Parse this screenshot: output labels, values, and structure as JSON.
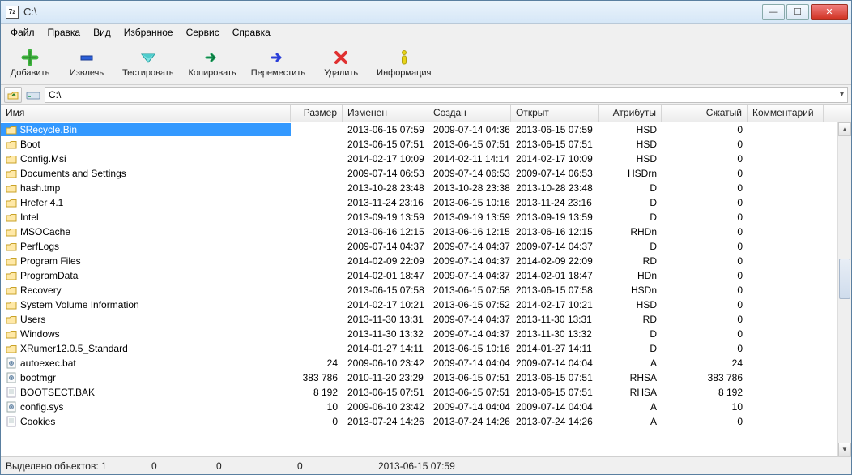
{
  "window": {
    "title": "C:\\"
  },
  "menu": {
    "items": [
      "Файл",
      "Правка",
      "Вид",
      "Избранное",
      "Сервис",
      "Справка"
    ]
  },
  "toolbar": {
    "buttons": [
      {
        "key": "add",
        "label": "Добавить"
      },
      {
        "key": "extract",
        "label": "Извлечь"
      },
      {
        "key": "test",
        "label": "Тестировать"
      },
      {
        "key": "copy",
        "label": "Копировать"
      },
      {
        "key": "move",
        "label": "Переместить"
      },
      {
        "key": "delete",
        "label": "Удалить"
      },
      {
        "key": "info",
        "label": "Информация"
      }
    ]
  },
  "path": {
    "value": "C:\\"
  },
  "columns": {
    "name": "Имя",
    "size": "Размер",
    "modified": "Изменен",
    "created": "Создан",
    "accessed": "Открыт",
    "attr": "Атрибуты",
    "compressed": "Сжатый",
    "comment": "Комментарий"
  },
  "rows": [
    {
      "type": "folder",
      "name": "$Recycle.Bin",
      "size": "",
      "mod": "2013-06-15 07:59",
      "crt": "2009-07-14 04:36",
      "acc": "2013-06-15 07:59",
      "attr": "HSD",
      "comp": "0",
      "sel": true
    },
    {
      "type": "folder",
      "name": "Boot",
      "size": "",
      "mod": "2013-06-15 07:51",
      "crt": "2013-06-15 07:51",
      "acc": "2013-06-15 07:51",
      "attr": "HSD",
      "comp": "0"
    },
    {
      "type": "folder",
      "name": "Config.Msi",
      "size": "",
      "mod": "2014-02-17 10:09",
      "crt": "2014-02-11 14:14",
      "acc": "2014-02-17 10:09",
      "attr": "HSD",
      "comp": "0"
    },
    {
      "type": "folder",
      "name": "Documents and Settings",
      "size": "",
      "mod": "2009-07-14 06:53",
      "crt": "2009-07-14 06:53",
      "acc": "2009-07-14 06:53",
      "attr": "HSDrn",
      "comp": "0"
    },
    {
      "type": "folder",
      "name": "hash.tmp",
      "size": "",
      "mod": "2013-10-28 23:48",
      "crt": "2013-10-28 23:38",
      "acc": "2013-10-28 23:48",
      "attr": "D",
      "comp": "0"
    },
    {
      "type": "folder",
      "name": "Hrefer 4.1",
      "size": "",
      "mod": "2013-11-24 23:16",
      "crt": "2013-06-15 10:16",
      "acc": "2013-11-24 23:16",
      "attr": "D",
      "comp": "0"
    },
    {
      "type": "folder",
      "name": "Intel",
      "size": "",
      "mod": "2013-09-19 13:59",
      "crt": "2013-09-19 13:59",
      "acc": "2013-09-19 13:59",
      "attr": "D",
      "comp": "0"
    },
    {
      "type": "folder",
      "name": "MSOCache",
      "size": "",
      "mod": "2013-06-16 12:15",
      "crt": "2013-06-16 12:15",
      "acc": "2013-06-16 12:15",
      "attr": "RHDn",
      "comp": "0"
    },
    {
      "type": "folder",
      "name": "PerfLogs",
      "size": "",
      "mod": "2009-07-14 04:37",
      "crt": "2009-07-14 04:37",
      "acc": "2009-07-14 04:37",
      "attr": "D",
      "comp": "0"
    },
    {
      "type": "folder",
      "name": "Program Files",
      "size": "",
      "mod": "2014-02-09 22:09",
      "crt": "2009-07-14 04:37",
      "acc": "2014-02-09 22:09",
      "attr": "RD",
      "comp": "0"
    },
    {
      "type": "folder",
      "name": "ProgramData",
      "size": "",
      "mod": "2014-02-01 18:47",
      "crt": "2009-07-14 04:37",
      "acc": "2014-02-01 18:47",
      "attr": "HDn",
      "comp": "0"
    },
    {
      "type": "folder",
      "name": "Recovery",
      "size": "",
      "mod": "2013-06-15 07:58",
      "crt": "2013-06-15 07:58",
      "acc": "2013-06-15 07:58",
      "attr": "HSDn",
      "comp": "0"
    },
    {
      "type": "folder",
      "name": "System Volume Information",
      "size": "",
      "mod": "2014-02-17 10:21",
      "crt": "2013-06-15 07:52",
      "acc": "2014-02-17 10:21",
      "attr": "HSD",
      "comp": "0"
    },
    {
      "type": "folder",
      "name": "Users",
      "size": "",
      "mod": "2013-11-30 13:31",
      "crt": "2009-07-14 04:37",
      "acc": "2013-11-30 13:31",
      "attr": "RD",
      "comp": "0"
    },
    {
      "type": "folder",
      "name": "Windows",
      "size": "",
      "mod": "2013-11-30 13:32",
      "crt": "2009-07-14 04:37",
      "acc": "2013-11-30 13:32",
      "attr": "D",
      "comp": "0"
    },
    {
      "type": "folder",
      "name": "XRumer12.0.5_Standard",
      "size": "",
      "mod": "2014-01-27 14:11",
      "crt": "2013-06-15 10:16",
      "acc": "2014-01-27 14:11",
      "attr": "D",
      "comp": "0"
    },
    {
      "type": "file-sys",
      "name": "autoexec.bat",
      "size": "24",
      "mod": "2009-06-10 23:42",
      "crt": "2009-07-14 04:04",
      "acc": "2009-07-14 04:04",
      "attr": "A",
      "comp": "24"
    },
    {
      "type": "file-sys",
      "name": "bootmgr",
      "size": "383 786",
      "mod": "2010-11-20 23:29",
      "crt": "2013-06-15 07:51",
      "acc": "2013-06-15 07:51",
      "attr": "RHSA",
      "comp": "383 786"
    },
    {
      "type": "file",
      "name": "BOOTSECT.BAK",
      "size": "8 192",
      "mod": "2013-06-15 07:51",
      "crt": "2013-06-15 07:51",
      "acc": "2013-06-15 07:51",
      "attr": "RHSA",
      "comp": "8 192"
    },
    {
      "type": "file-sys",
      "name": "config.sys",
      "size": "10",
      "mod": "2009-06-10 23:42",
      "crt": "2009-07-14 04:04",
      "acc": "2009-07-14 04:04",
      "attr": "A",
      "comp": "10"
    },
    {
      "type": "file",
      "name": "Cookies",
      "size": "0",
      "mod": "2013-07-24 14:26",
      "crt": "2013-07-24 14:26",
      "acc": "2013-07-24 14:26",
      "attr": "A",
      "comp": "0"
    }
  ],
  "status": {
    "sel": "Выделено объектов: 1",
    "v1": "0",
    "v2": "0",
    "v3": "0",
    "date": "2013-06-15 07:59"
  }
}
